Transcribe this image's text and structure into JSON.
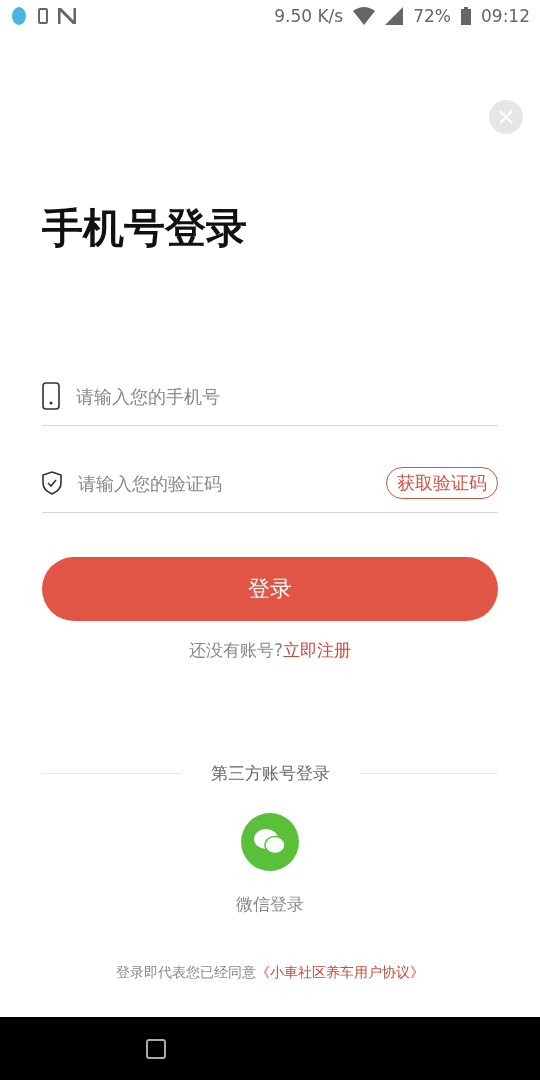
{
  "status_bar": {
    "speed": "9.50 K/s",
    "battery": "72%",
    "time": "09:12"
  },
  "title": "手机号登录",
  "phone_field": {
    "placeholder": "请输入您的手机号"
  },
  "code_field": {
    "placeholder": "请输入您的验证码",
    "button": "获取验证码"
  },
  "login_button": "登录",
  "register": {
    "prompt": "还没有账号?",
    "link": "立即注册"
  },
  "third_party": {
    "heading": "第三方账号登录",
    "wechat_label": "微信登录"
  },
  "agreement": {
    "text": "登录即代表您已经同意",
    "link": "《小車社区养车用户协议》"
  }
}
